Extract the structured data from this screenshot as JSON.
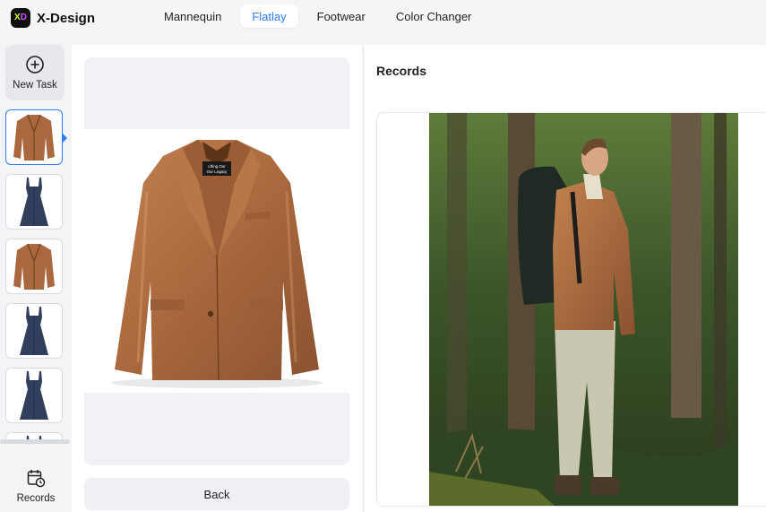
{
  "brand": {
    "name": "X-Design",
    "logo_left": "X",
    "logo_right": "D"
  },
  "nav": {
    "tabs": [
      {
        "label": "Mannequin",
        "active": false
      },
      {
        "label": "Flatlay",
        "active": true
      },
      {
        "label": "Footwear",
        "active": false
      },
      {
        "label": "Color Changer",
        "active": false
      }
    ]
  },
  "sidebar": {
    "new_task_label": "New Task",
    "records_label": "Records",
    "thumbnails": [
      {
        "item": "leather-jacket",
        "selected": true
      },
      {
        "item": "denim-dress",
        "selected": false
      },
      {
        "item": "leather-jacket",
        "selected": false
      },
      {
        "item": "denim-dress",
        "selected": false
      },
      {
        "item": "denim-dress",
        "selected": false
      },
      {
        "item": "denim-dress",
        "selected": false
      }
    ]
  },
  "preview": {
    "jacket_tag_line1": "Lfting Our",
    "jacket_tag_line2": "Our Legacy",
    "back_label": "Back"
  },
  "records": {
    "title": "Records"
  },
  "colors": {
    "accent": "#2f7df6",
    "leather": "#a9683d",
    "denim": "#2f3f5c"
  }
}
